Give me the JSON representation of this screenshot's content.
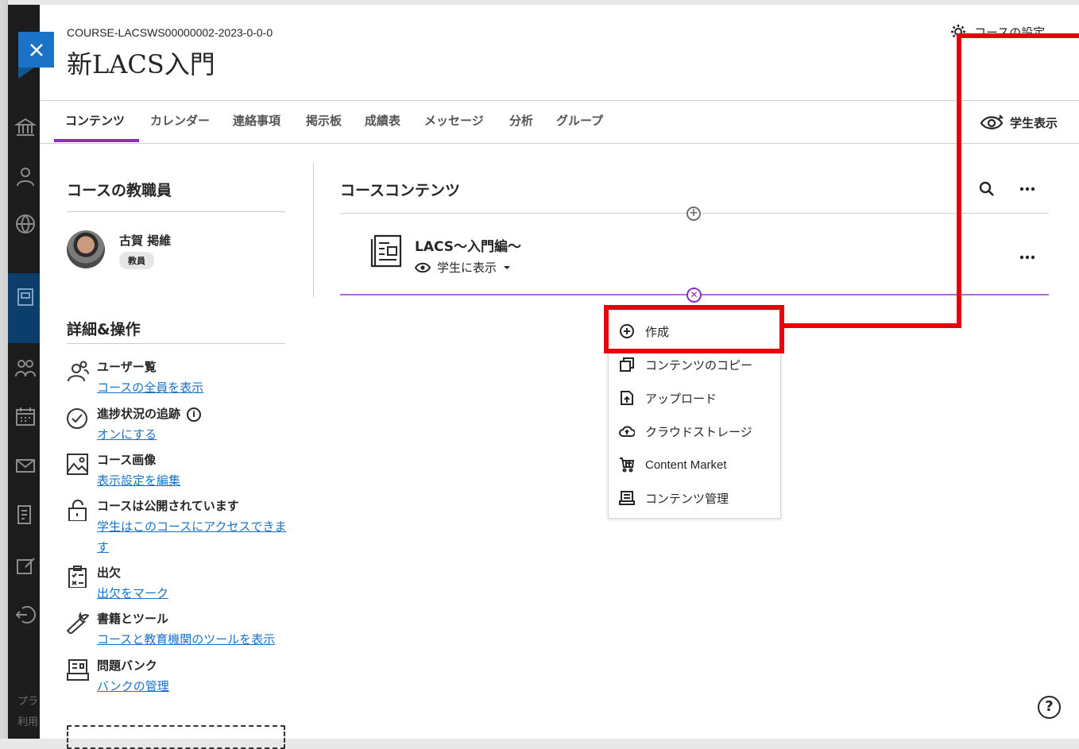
{
  "course": {
    "id": "COURSE-LACSWS00000002-2023-0-0-0",
    "title": "新LACS入門",
    "settings_label": "コースの設定"
  },
  "tabs": [
    {
      "label": "コンテンツ",
      "active": true
    },
    {
      "label": "カレンダー"
    },
    {
      "label": "連絡事項"
    },
    {
      "label": "掲示板"
    },
    {
      "label": "成績表"
    },
    {
      "label": "メッセージ"
    },
    {
      "label": "分析"
    },
    {
      "label": "グループ"
    }
  ],
  "student_view_label": "学生表示",
  "faculty": {
    "heading": "コースの教職員",
    "name": "古賀 掲維",
    "role": "教員"
  },
  "details": {
    "heading": "詳細&操作",
    "items": [
      {
        "title": "ユーザー覧",
        "link": "コースの全員を表示",
        "icon": "users-icon"
      },
      {
        "title": "進捗状況の追跡",
        "link": "オンにする",
        "icon": "check-circle-icon"
      },
      {
        "title": "コース画像",
        "link": "表示設定を編集",
        "icon": "image-icon"
      },
      {
        "title": "コースは公開されています",
        "link": "学生はこのコースにアクセスできます",
        "icon": "unlock-icon"
      },
      {
        "title": "出欠",
        "link": "出欠をマーク",
        "icon": "clipboard-icon"
      },
      {
        "title": "書籍とツール",
        "link": "コースと教育機関のツールを表示",
        "icon": "wrench-icon"
      },
      {
        "title": "問題バンク",
        "link": "バンクの管理",
        "icon": "question-bank-icon"
      }
    ]
  },
  "content": {
    "heading": "コースコンテンツ",
    "item": {
      "title": "LACS〜入門編〜",
      "visibility": "学生に表示"
    }
  },
  "menu": {
    "items": [
      {
        "label": "作成",
        "icon": "plus-circle-icon"
      },
      {
        "label": "コンテンツのコピー",
        "icon": "copy-icon"
      },
      {
        "label": "アップロード",
        "icon": "upload-icon"
      },
      {
        "label": "クラウドストレージ",
        "icon": "cloud-icon"
      },
      {
        "label": "Content Market",
        "icon": "cart-icon"
      },
      {
        "label": "コンテンツ管理",
        "icon": "content-manage-icon"
      }
    ]
  },
  "base_nav_footer": [
    "プラ",
    "利用"
  ],
  "colors": {
    "accent_purple": "#8c2fb8",
    "link_blue": "#1a73c7",
    "highlight_red": "#e8000a",
    "nav_dark": "#1c1c1c"
  }
}
